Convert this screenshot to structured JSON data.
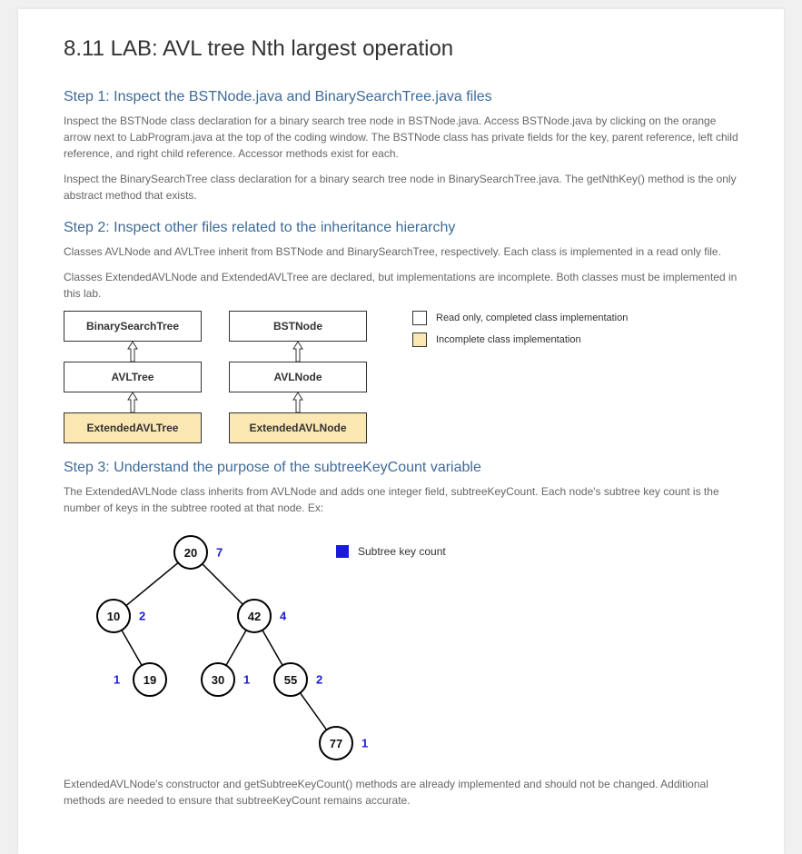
{
  "title": "8.11 LAB: AVL tree Nth largest operation",
  "step1": {
    "heading": "Step 1: Inspect the BSTNode.java and BinarySearchTree.java files",
    "p1": "Inspect the BSTNode class declaration for a binary search tree node in BSTNode.java. Access BSTNode.java by clicking on the orange arrow next to LabProgram.java at the top of the coding window. The BSTNode class has private fields for the key, parent reference, left child reference, and right child reference. Accessor methods exist for each.",
    "p2": "Inspect the BinarySearchTree class declaration for a binary search tree node in BinarySearchTree.java. The getNthKey() method is the only abstract method that exists."
  },
  "step2": {
    "heading": "Step 2: Inspect other files related to the inheritance hierarchy",
    "p1": "Classes AVLNode and AVLTree inherit from BSTNode and BinarySearchTree, respectively. Each class is implemented in a read only file.",
    "p2": "Classes ExtendedAVLNode and ExtendedAVLTree are declared, but implementations are incomplete. Both classes must be implemented in this lab.",
    "col1": {
      "top": "BinarySearchTree",
      "mid": "AVLTree",
      "bot": "ExtendedAVLTree"
    },
    "col2": {
      "top": "BSTNode",
      "mid": "AVLNode",
      "bot": "ExtendedAVLNode"
    },
    "legend1": "Read only, completed class implementation",
    "legend2": "Incomplete class implementation"
  },
  "step3": {
    "heading": "Step 3: Understand the purpose of the subtreeKeyCount variable",
    "p1": "The ExtendedAVLNode class inherits from AVLNode and adds one integer field, subtreeKeyCount. Each node's subtree key count is the number of keys in the subtree rooted at that node. Ex:",
    "legend": "Subtree key count",
    "p2": "ExtendedAVLNode's constructor and getSubtreeKeyCount() methods are already implemented and should not be changed. Additional methods are needed to ensure that subtreeKeyCount remains accurate."
  },
  "tree": {
    "n20": {
      "key": "20",
      "skc": "7"
    },
    "n10": {
      "key": "10",
      "skc": "2"
    },
    "n42": {
      "key": "42",
      "skc": "4"
    },
    "n19": {
      "key": "19",
      "skc": "1"
    },
    "n30": {
      "key": "30",
      "skc": "1"
    },
    "n55": {
      "key": "55",
      "skc": "2"
    },
    "n77": {
      "key": "77",
      "skc": "1"
    }
  }
}
